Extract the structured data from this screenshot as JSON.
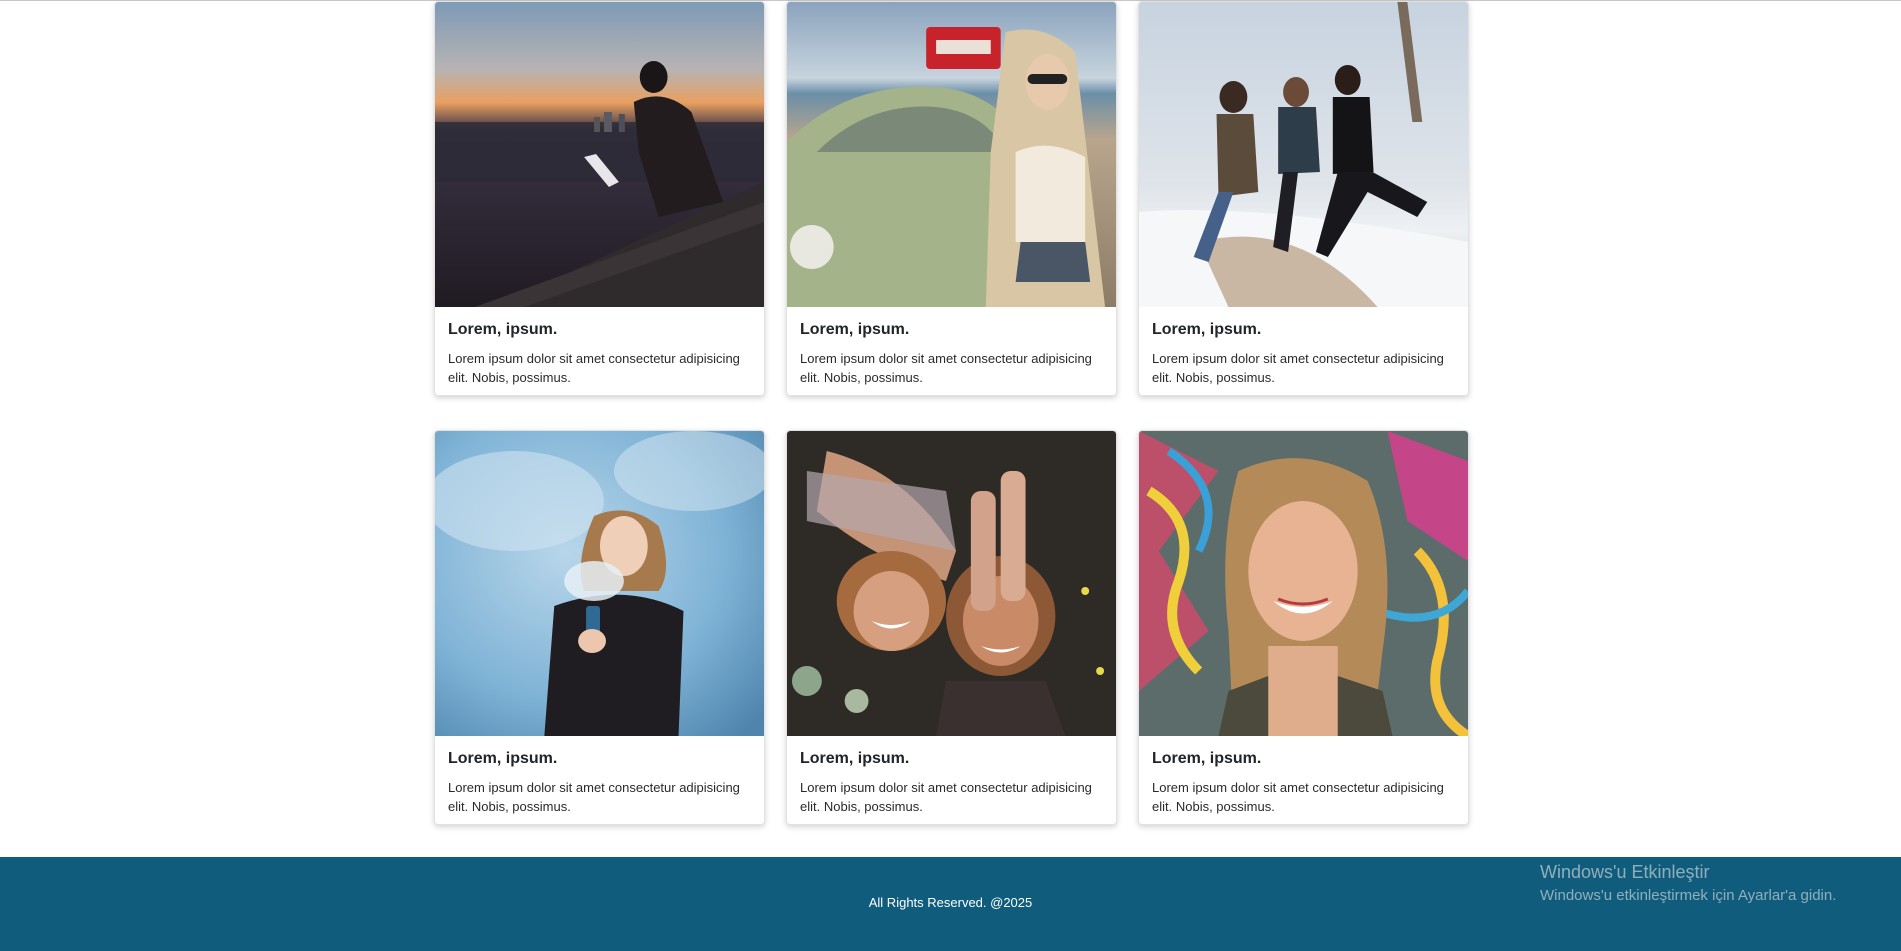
{
  "cards": [
    {
      "title": "Lorem, ipsum.",
      "text": "Lorem ipsum dolor sit amet consectetur adipisicing elit. Nobis, possimus.",
      "image": "man-with-laptop-at-sunset"
    },
    {
      "title": "Lorem, ipsum.",
      "text": "Lorem ipsum dolor sit amet consectetur adipisicing elit. Nobis, possimus.",
      "image": "woman-leaning-on-green-beetle-car"
    },
    {
      "title": "Lorem, ipsum.",
      "text": "Lorem ipsum dolor sit amet consectetur adipisicing elit. Nobis, possimus.",
      "image": "three-friends-jumping-in-snow"
    },
    {
      "title": "Lorem, ipsum.",
      "text": "Lorem ipsum dolor sit amet consectetur adipisicing elit. Nobis, possimus.",
      "image": "woman-with-blue-smoke"
    },
    {
      "title": "Lorem, ipsum.",
      "text": "Lorem ipsum dolor sit amet consectetur adipisicing elit. Nobis, possimus.",
      "image": "two-women-covering-eyes-laughing"
    },
    {
      "title": "Lorem, ipsum.",
      "text": "Lorem ipsum dolor sit amet consectetur adipisicing elit. Nobis, possimus.",
      "image": "smiling-woman-graffiti-wall"
    }
  ],
  "footer": {
    "text": "All Rights Reserved. @2025"
  },
  "watermark": {
    "title": "Windows'u Etkinleştir",
    "subtitle": "Windows'u etkinleştirmek için Ayarlar'a gidin."
  },
  "colors": {
    "footer_bg": "#0f5c7c",
    "card_border": "#e2e2e2"
  }
}
